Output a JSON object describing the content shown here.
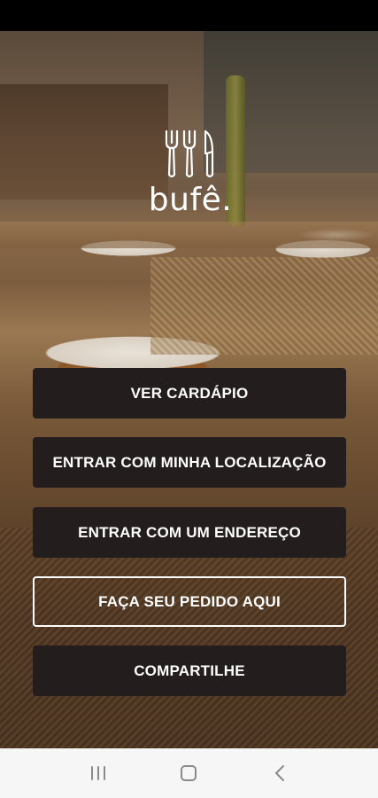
{
  "status_bar": {},
  "logo": {
    "text": "bufê.",
    "icon": "cutlery-icon"
  },
  "buttons": {
    "menu": "VER CARDÁPIO",
    "location": "ENTRAR COM MINHA LOCALIZAÇÃO",
    "address": "ENTRAR COM UM ENDEREÇO",
    "order": "FAÇA SEU PEDIDO AQUI",
    "share": "COMPARTILHE"
  },
  "nav": {
    "recents_icon": "recents-icon",
    "home_icon": "home-icon",
    "back_icon": "back-icon"
  },
  "colors": {
    "button_bg": "#231d1d",
    "button_text": "#ffffff",
    "nav_bg": "#f6f6f6"
  }
}
